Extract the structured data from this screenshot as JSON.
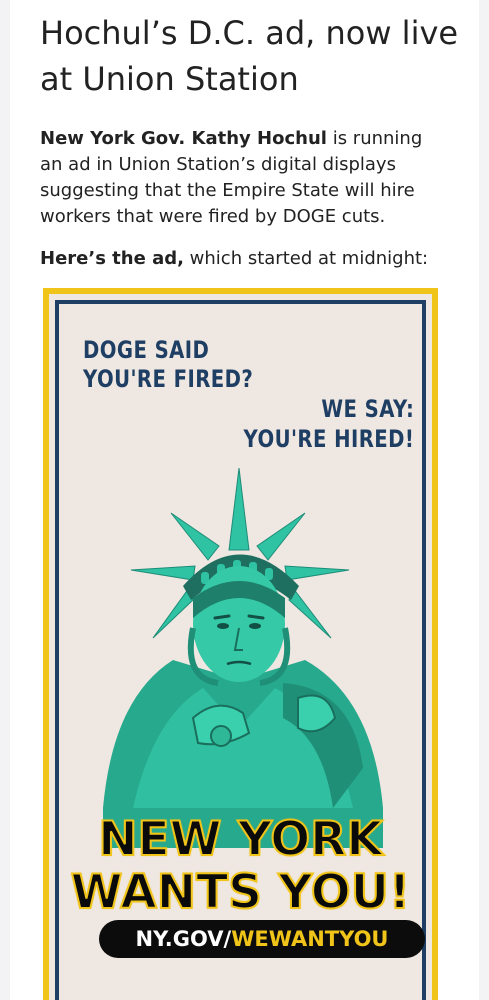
{
  "article": {
    "headline": "Hochul’s D.C. ad, now live at Union Station",
    "p1_bold": "New York Gov. Kathy Hochul",
    "p1_text": " is running an ad in Union Station’s digital displays suggesting that the Empire State will hire workers that were fired by DOGE cuts.",
    "p2_bold": "Here’s the ad,",
    "p2_text": " which started at midnight:"
  },
  "ad": {
    "top_left_line1": "DOGE SAID",
    "top_left_line2": "YOU'RE FIRED?",
    "top_right_line1": "WE SAY:",
    "top_right_line2": "YOU'RE HIRED!",
    "headline_line1": "NEW YORK",
    "headline_line2": "WANTS YOU!",
    "url_prefix": "NY.GOV/",
    "url_suffix": "WEWANTYOU",
    "image_subject": "statue-of-liberty-pointing"
  },
  "colors": {
    "ad_background": "#efe7e1",
    "frame_gold": "#f0c419",
    "frame_navy": "#1e3f63",
    "statue_teal": "#2ebfa0"
  }
}
